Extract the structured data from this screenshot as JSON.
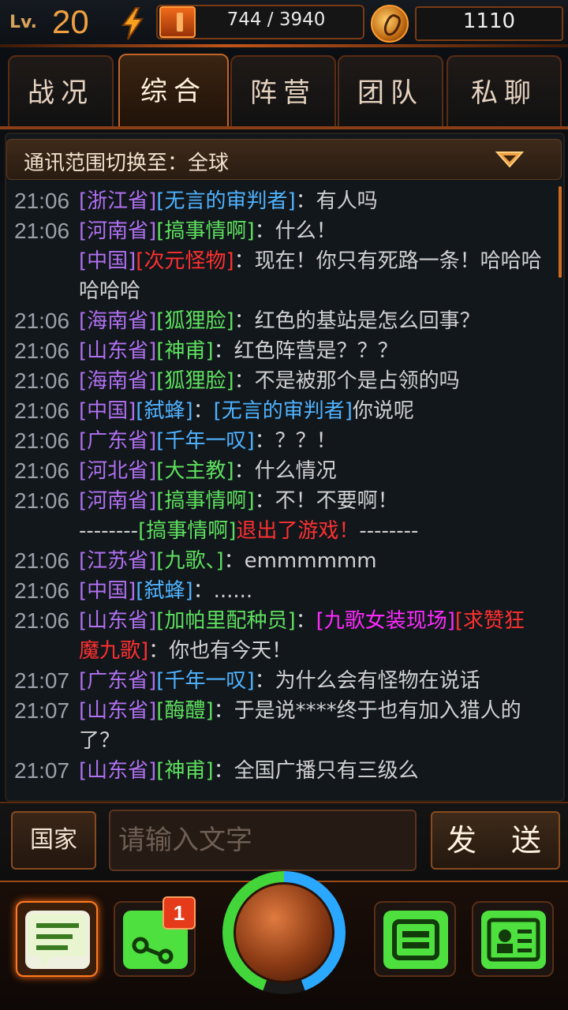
{
  "header": {
    "level_label": "Lv.",
    "level": "20",
    "energy": "744 / 3940",
    "gold": "1110"
  },
  "tabs": [
    {
      "label": "战况",
      "active": false
    },
    {
      "label": "综合",
      "active": true
    },
    {
      "label": "阵营",
      "active": false
    },
    {
      "label": "团队",
      "active": false
    },
    {
      "label": "私聊",
      "active": false
    }
  ],
  "chat": {
    "range_label": "通讯范围切换至：全球",
    "messages": [
      {
        "time": "21:06",
        "parts": [
          [
            "prov",
            "[浙江省]"
          ],
          [
            "blue",
            "[无言的审判者]"
          ],
          [
            "text",
            "：有人吗"
          ]
        ]
      },
      {
        "time": "21:06",
        "parts": [
          [
            "prov",
            "[河南省]"
          ],
          [
            "green",
            "[搞事情啊]"
          ],
          [
            "text",
            "：什么！"
          ]
        ]
      },
      {
        "time": "",
        "parts": [
          [
            "prov",
            "[中国]"
          ],
          [
            "red",
            "[次元怪物]"
          ],
          [
            "text",
            "：现在！你只有死路一条！哈哈哈哈哈哈"
          ]
        ]
      },
      {
        "time": "21:06",
        "parts": [
          [
            "prov",
            "[海南省]"
          ],
          [
            "green",
            "[狐狸脸]"
          ],
          [
            "text",
            "：红色的基站是怎么回事？"
          ]
        ]
      },
      {
        "time": "21:06",
        "parts": [
          [
            "prov",
            "[山东省]"
          ],
          [
            "green",
            "[神甫]"
          ],
          [
            "text",
            "：红色阵营是？？？"
          ]
        ]
      },
      {
        "time": "21:06",
        "parts": [
          [
            "prov",
            "[海南省]"
          ],
          [
            "green",
            "[狐狸脸]"
          ],
          [
            "text",
            "：不是被那个是占领的吗"
          ]
        ]
      },
      {
        "time": "21:06",
        "parts": [
          [
            "prov",
            "[中国]"
          ],
          [
            "blue",
            "[弑蜂]"
          ],
          [
            "text",
            "："
          ],
          [
            "blue",
            "[无言的审判者]"
          ],
          [
            "text",
            "你说呢"
          ]
        ]
      },
      {
        "time": "21:06",
        "parts": [
          [
            "prov",
            "[广东省]"
          ],
          [
            "blue",
            "[千年一叹]"
          ],
          [
            "text",
            "：？？！"
          ]
        ]
      },
      {
        "time": "21:06",
        "parts": [
          [
            "prov",
            "[河北省]"
          ],
          [
            "green",
            "[大主教]"
          ],
          [
            "text",
            "：什么情况"
          ]
        ]
      },
      {
        "time": "21:06",
        "parts": [
          [
            "prov",
            "[河南省]"
          ],
          [
            "green",
            "[搞事情啊]"
          ],
          [
            "text",
            "：不！不要啊！"
          ]
        ]
      },
      {
        "time": "",
        "system": true,
        "parts": [
          [
            "text",
            "--------"
          ],
          [
            "green",
            "[搞事情啊]"
          ],
          [
            "red",
            "退出了游戏！"
          ],
          [
            "text",
            "--------"
          ]
        ]
      },
      {
        "time": "21:06",
        "parts": [
          [
            "prov",
            "[江苏省]"
          ],
          [
            "green",
            "[九歌、]"
          ],
          [
            "text",
            "：emmmmmm"
          ]
        ]
      },
      {
        "time": "21:06",
        "parts": [
          [
            "prov",
            "[中国]"
          ],
          [
            "blue",
            "[弑蜂]"
          ],
          [
            "text",
            "：......"
          ]
        ]
      },
      {
        "time": "21:06",
        "parts": [
          [
            "prov",
            "[山东省]"
          ],
          [
            "green",
            "[加帕里配种员]"
          ],
          [
            "text",
            "："
          ],
          [
            "pink",
            "[九歌女装现场]"
          ],
          [
            "red",
            "[求赞狂魔九歌]"
          ],
          [
            "text",
            "：你也有今天！"
          ]
        ]
      },
      {
        "time": "21:07",
        "parts": [
          [
            "prov",
            "[广东省]"
          ],
          [
            "blue",
            "[千年一叹]"
          ],
          [
            "text",
            "：为什么会有怪物在说话"
          ]
        ]
      },
      {
        "time": "21:07",
        "parts": [
          [
            "prov",
            "[山东省]"
          ],
          [
            "green",
            "[酶醴]"
          ],
          [
            "text",
            "：于是说****终于也有加入猎人的了？"
          ]
        ]
      },
      {
        "time": "21:07",
        "parts": [
          [
            "prov",
            "[山东省]"
          ],
          [
            "green",
            "[神甫]"
          ],
          [
            "text",
            "：全国广播只有三级么"
          ]
        ]
      }
    ]
  },
  "input": {
    "country_label": "国家",
    "placeholder": "请输入文字",
    "send_label": "发 送"
  },
  "nav": {
    "badge": "1",
    "items": [
      {
        "icon": "chat-icon",
        "active": true
      },
      {
        "icon": "share-icon",
        "active": false
      },
      {
        "icon": "globe-icon",
        "active": false
      },
      {
        "icon": "team-icon",
        "active": false
      },
      {
        "icon": "profile-card-icon",
        "active": false
      }
    ]
  },
  "colors": {
    "accent": "#c06426",
    "province": "#b070f0",
    "blue_name": "#4fb3ff",
    "green_name": "#5ee05e",
    "red_text": "#ff3030",
    "pink_name": "#ff2aff"
  }
}
